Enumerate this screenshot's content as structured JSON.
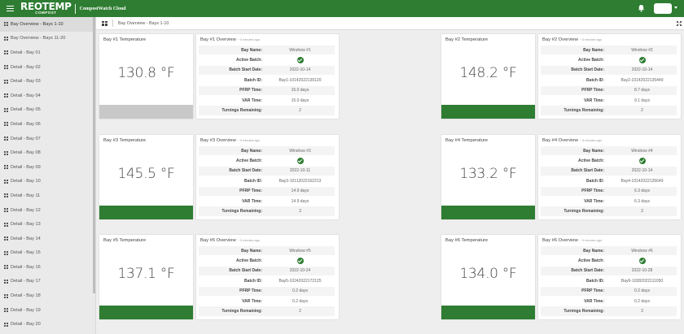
{
  "header": {
    "brand_name": "REOTEMP",
    "brand_sub": "COMPOST",
    "app_name": "CompostWatch Cloud",
    "bell_icon": "bell-icon",
    "menu_icon": "hamburger-menu-icon"
  },
  "colors": {
    "accent": "#2e7d32",
    "gray_bar": "#c8c8c8"
  },
  "sidebar": {
    "items": [
      {
        "label": "Bay Overview - Bays 1-10",
        "active": true
      },
      {
        "label": "Bay Overview - Bays 11-20"
      },
      {
        "label": "Detail - Bay 01"
      },
      {
        "label": "Detail - Bay 02"
      },
      {
        "label": "Detail - Bay 03"
      },
      {
        "label": "Detail - Bay 04"
      },
      {
        "label": "Detail - Bay 05"
      },
      {
        "label": "Detail - Bay 06"
      },
      {
        "label": "Detail - Bay 07"
      },
      {
        "label": "Detail - Bay 08"
      },
      {
        "label": "Detail - Bay 09"
      },
      {
        "label": "Detail - Bay 10"
      },
      {
        "label": "Detail - Bay 11"
      },
      {
        "label": "Detail - Bay 12"
      },
      {
        "label": "Detail - Bay 13"
      },
      {
        "label": "Detail - Bay 14"
      },
      {
        "label": "Detail - Bay 15"
      },
      {
        "label": "Detail - Bay 16"
      },
      {
        "label": "Detail - Bay 17"
      },
      {
        "label": "Detail - Bay 18"
      },
      {
        "label": "Detail - Bay 19"
      },
      {
        "label": "Detail - Bay 20"
      }
    ]
  },
  "breadcrumb": {
    "text": "Bay Overview - Bays 1-10"
  },
  "row_labels": [
    "Bay Name:",
    "Active Batch:",
    "Batch Start Date:",
    "Batch ID:",
    "PFRP Time:",
    "VAR Time:",
    "Turnings Remaining:"
  ],
  "bays": [
    {
      "temp_title": "Bay #1 Temperature",
      "temp": "130.8 °F",
      "status": "gray",
      "ov_title": "Bay #1 Overview",
      "age": "~ 5 minutes ago",
      "values": [
        "Windrow #1",
        "check",
        "2022-10-14",
        "Bay1-10142022135120",
        "15.0 days",
        "15.0 days",
        "2"
      ]
    },
    {
      "temp_title": "Bay #2 Temperature",
      "temp": "148.2 °F",
      "status": "green",
      "ov_title": "Bay #2 Overview",
      "age": "~ 5 minutes ago",
      "values": [
        "Windrow #2",
        "check",
        "2022-10-14",
        "Bay2-10142022135449",
        "8.7 days",
        "9.1 days",
        "2"
      ]
    },
    {
      "temp_title": "Bay #3 Temperature",
      "temp": "145.5 °F",
      "status": "green",
      "ov_title": "Bay #3 Overview",
      "age": "~ 5 minutes ago",
      "values": [
        "Windrow #3",
        "check",
        "2022-10-11",
        "Bay3-10112022162213",
        "14.9 days",
        "14.9 days",
        "3"
      ]
    },
    {
      "temp_title": "Bay #4 Temperature",
      "temp": "133.2 °F",
      "status": "green",
      "ov_title": "Bay #4 Overview",
      "age": "~ 5 minutes ago",
      "values": [
        "Windrow #4",
        "check",
        "2022-10-14",
        "Bay4-10142022135649",
        "6.3 days",
        "6.3 days",
        "3"
      ]
    },
    {
      "temp_title": "Bay #5 Temperature",
      "temp": "137.1 °F",
      "status": "green",
      "ov_title": "Bay #5 Overview",
      "age": "~ 5 minutes ago",
      "values": [
        "Windrow #5",
        "check",
        "2022-10-24",
        "Bay5-10242022172125",
        "0.2 days",
        "0.2 days",
        "2"
      ]
    },
    {
      "temp_title": "Bay #6 Temperature",
      "temp": "134.0 °F",
      "status": "green",
      "ov_title": "Bay #6 Overview",
      "age": "~ 5 minutes ago",
      "values": [
        "Windrow #6",
        "check",
        "2022-10-28",
        "Bay6-10282022111050",
        "0.2 days",
        "0.2 days",
        "3"
      ]
    }
  ]
}
